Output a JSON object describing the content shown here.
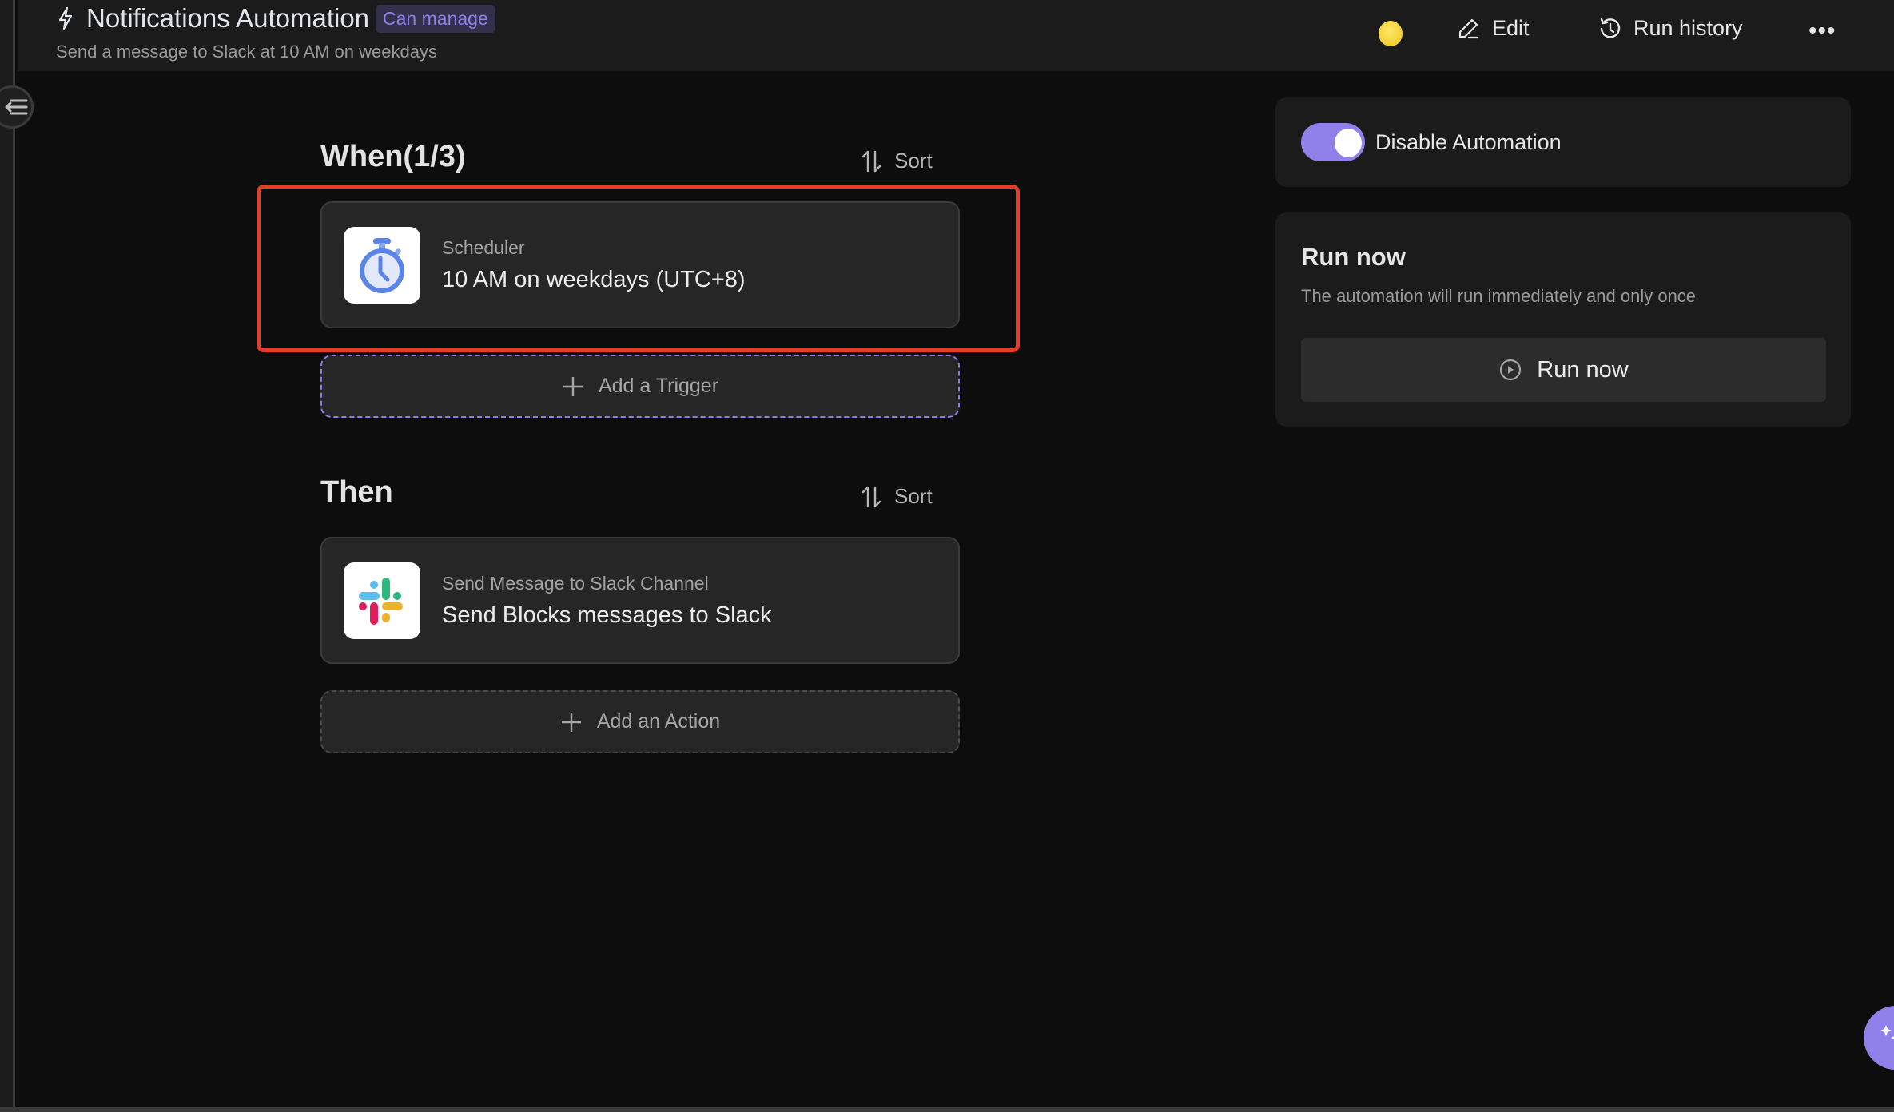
{
  "header": {
    "title": "Notifications Automation",
    "permission_badge": "Can manage",
    "subtitle": "Send a message to Slack at 10 AM on weekdays",
    "status_emoji": "yellow-circle",
    "actions": {
      "edit_label": "Edit",
      "run_history_label": "Run history",
      "more_label": "•••"
    }
  },
  "when_section": {
    "title": "When(1/3)",
    "sort_label": "Sort",
    "triggers": [
      {
        "icon": "stopwatch-icon",
        "type_label": "Scheduler",
        "description": "10 AM on weekdays (UTC+8)",
        "highlighted": true
      }
    ],
    "add_label": "Add a Trigger"
  },
  "then_section": {
    "title": "Then",
    "sort_label": "Sort",
    "actions": [
      {
        "icon": "slack-icon",
        "type_label": "Send Message to Slack Channel",
        "description": "Send Blocks messages to Slack"
      }
    ],
    "add_label": "Add an Action"
  },
  "side_panel": {
    "toggle": {
      "label": "Disable Automation",
      "on": true
    },
    "run_now": {
      "title": "Run now",
      "description": "The automation will run immediately and only once",
      "button_label": "Run now"
    }
  },
  "colors": {
    "accent": "#8f80ea",
    "highlight_border": "#e43d28",
    "background": "#0d0d0d",
    "card": "#262626"
  }
}
